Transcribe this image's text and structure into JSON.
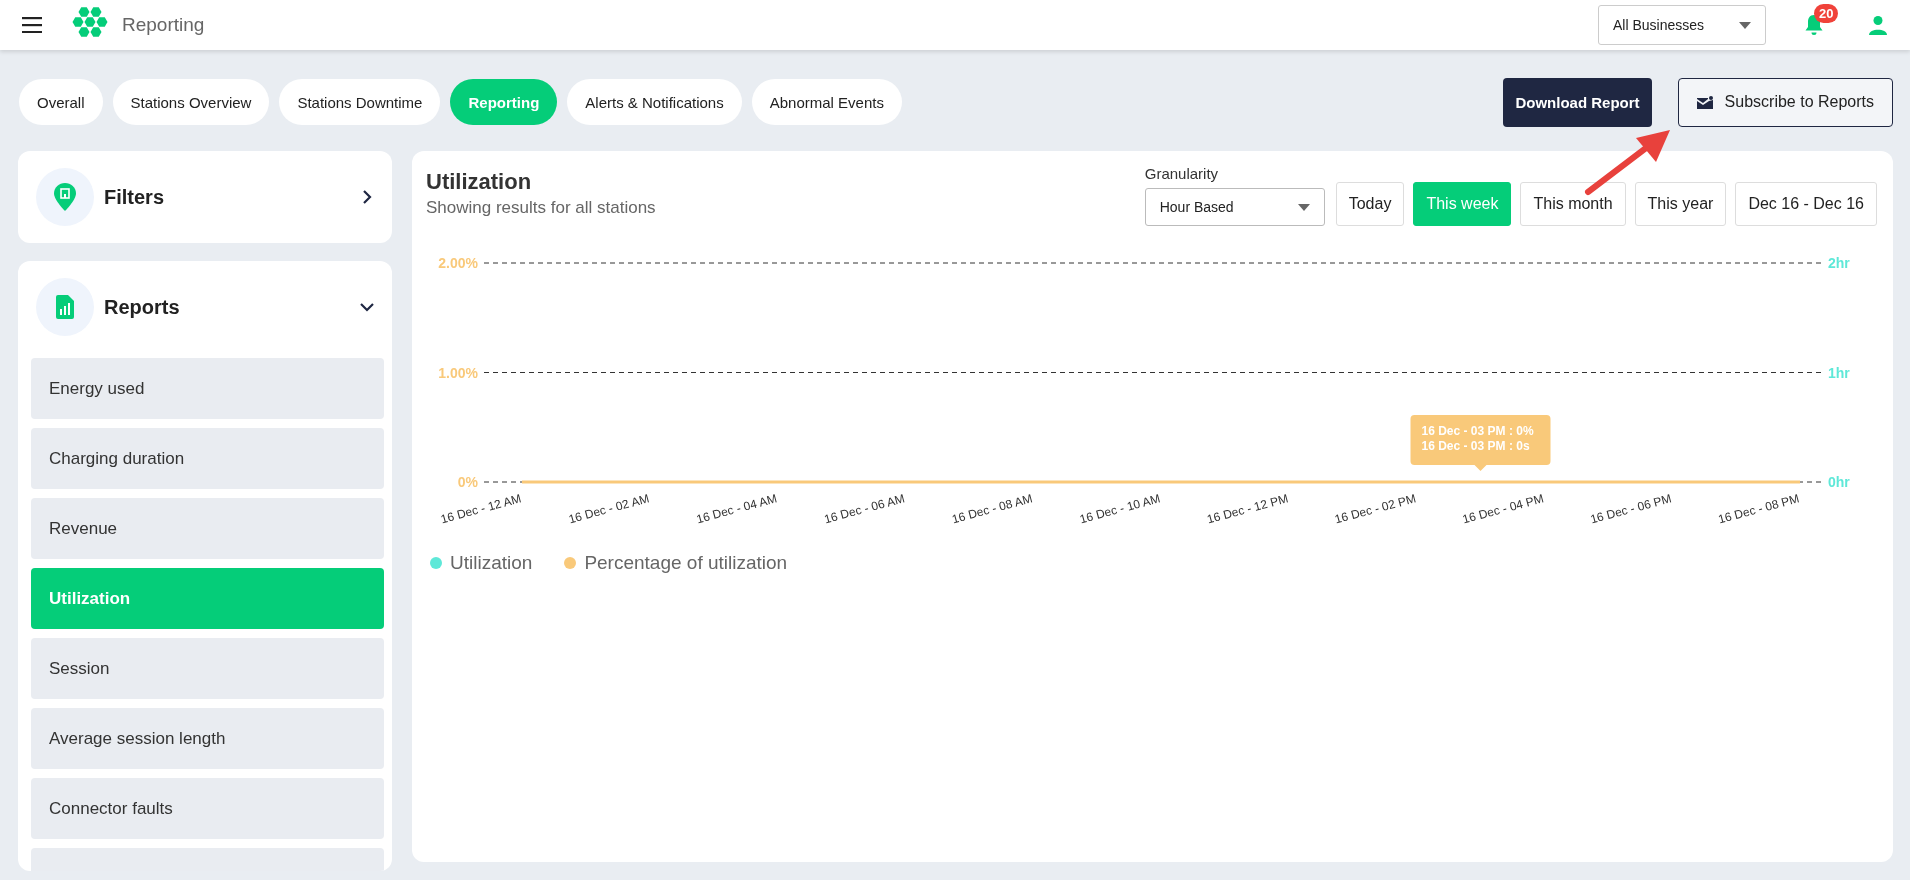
{
  "header": {
    "title": "Reporting",
    "business_select": {
      "value": "All Businesses"
    },
    "notifications": {
      "count": "20"
    }
  },
  "tabs": [
    {
      "label": "Overall",
      "selected": false
    },
    {
      "label": "Stations Overview",
      "selected": false
    },
    {
      "label": "Stations Downtime",
      "selected": false
    },
    {
      "label": "Reporting",
      "selected": true
    },
    {
      "label": "Alerts & Notifications",
      "selected": false
    },
    {
      "label": "Abnormal Events",
      "selected": false
    }
  ],
  "actions": {
    "download": "Download Report",
    "subscribe": "Subscribe to Reports"
  },
  "filters": {
    "title": "Filters",
    "expanded": false
  },
  "reports": {
    "title": "Reports",
    "expanded": true,
    "items": [
      {
        "label": "Energy used",
        "selected": false
      },
      {
        "label": "Charging duration",
        "selected": false
      },
      {
        "label": "Revenue",
        "selected": false
      },
      {
        "label": "Utilization",
        "selected": true
      },
      {
        "label": "Session",
        "selected": false
      },
      {
        "label": "Average session length",
        "selected": false
      },
      {
        "label": "Connector faults",
        "selected": false
      }
    ]
  },
  "chart_panel": {
    "title": "Utilization",
    "subtitle": "Showing results for all stations",
    "granularity": {
      "label": "Granularity",
      "value": "Hour Based"
    },
    "ranges": [
      {
        "label": "Today",
        "selected": false
      },
      {
        "label": "This week",
        "selected": true
      },
      {
        "label": "This month",
        "selected": false
      },
      {
        "label": "This year",
        "selected": false
      },
      {
        "label": "Dec 16 - Dec 16",
        "selected": false
      }
    ],
    "right_axis_labels": [
      "2hr",
      "1hr",
      "0hr"
    ],
    "tooltip": [
      "16 Dec - 03 PM : 0%",
      "16 Dec - 03 PM : 0s"
    ],
    "chart_data": {
      "type": "line",
      "categories": [
        "16 Dec - 12 AM",
        "16 Dec - 02 AM",
        "16 Dec - 04 AM",
        "16 Dec - 06 AM",
        "16 Dec - 08 AM",
        "16 Dec - 10 AM",
        "16 Dec - 12 PM",
        "16 Dec - 02 PM",
        "16 Dec - 04 PM",
        "16 Dec - 06 PM",
        "16 Dec - 08 PM"
      ],
      "legend": true,
      "series": [
        {
          "name": "Utilization",
          "color": "#5ee8d8",
          "values": [
            null,
            null,
            null,
            null,
            null,
            null,
            null,
            null,
            null,
            null,
            null
          ]
        },
        {
          "name": "Percentage of utilization",
          "color": "#f9c97a",
          "values": [
            0,
            0,
            0,
            0,
            0,
            0,
            0,
            0,
            0,
            0,
            0
          ]
        }
      ],
      "ylim": [
        0,
        2
      ],
      "yticks": [
        {
          "value": 0,
          "label": "0%"
        },
        {
          "value": 1,
          "label": "1.00%"
        },
        {
          "value": 2,
          "label": "2.00%"
        }
      ]
    }
  }
}
